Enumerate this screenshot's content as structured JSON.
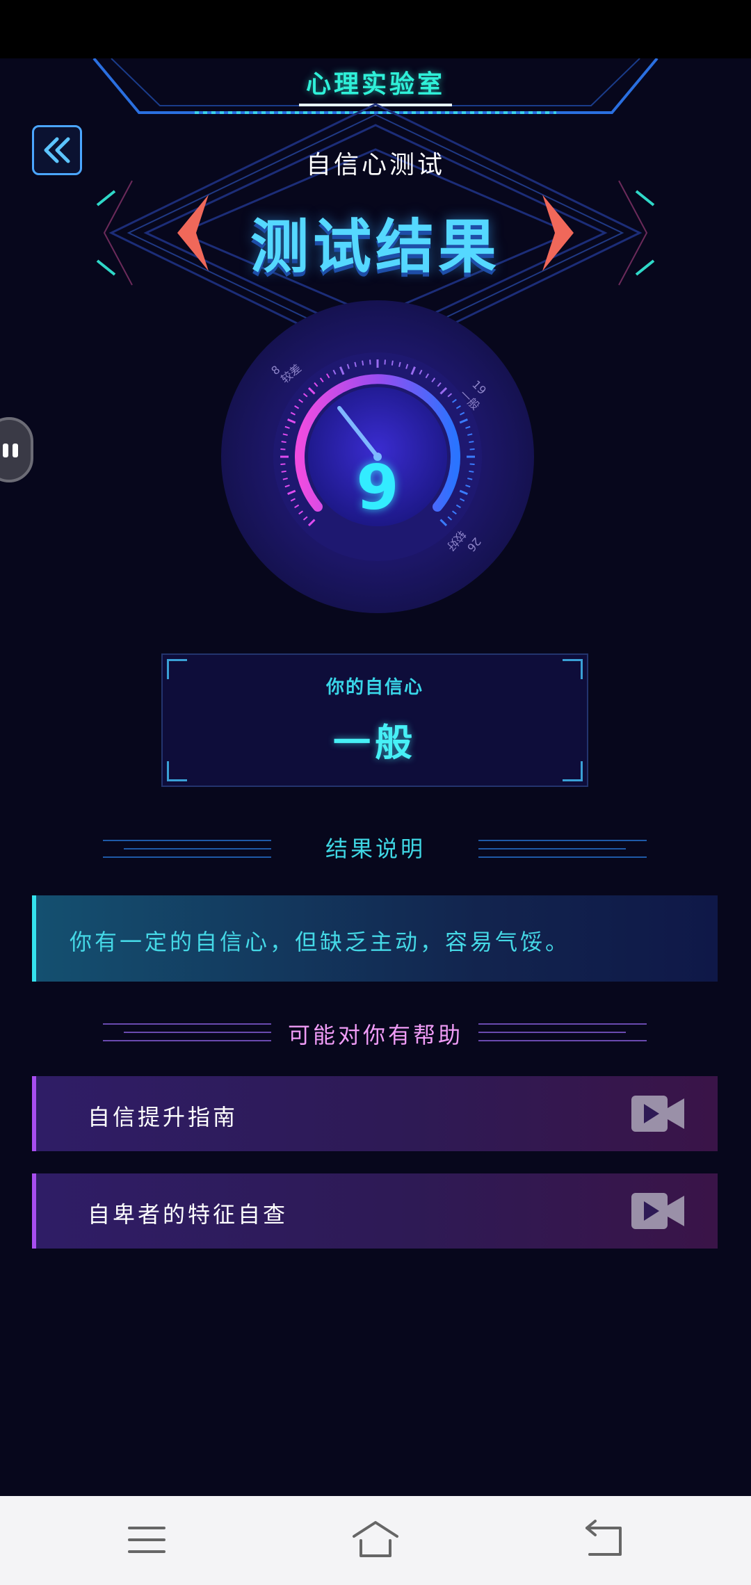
{
  "header": {
    "app_title": "心理实验室",
    "test_name": "自信心测试",
    "result_heading": "测试结果"
  },
  "gauge": {
    "score": "9",
    "level_marks": [
      {
        "value": "8",
        "label": "较差"
      },
      {
        "value": "19",
        "label": "一般"
      },
      {
        "value": "26",
        "label": "较好"
      }
    ]
  },
  "level_card": {
    "label": "你的自信心",
    "value": "一般"
  },
  "explanation": {
    "heading": "结果说明",
    "text": "你有一定的自信心，但缺乏主动，容易气馁。"
  },
  "help": {
    "heading": "可能对你有帮助",
    "items": [
      {
        "label": "自信提升指南",
        "icon": "video-icon"
      },
      {
        "label": "自卑者的特征自查",
        "icon": "video-icon"
      }
    ]
  },
  "nav": {
    "icons": [
      "menu-icon",
      "home-icon",
      "back-icon"
    ]
  },
  "colors": {
    "background": "#07071c",
    "accent_cyan": "#33ecff",
    "accent_magenta": "#e04cf0",
    "accent_purple": "#a84ef0"
  }
}
